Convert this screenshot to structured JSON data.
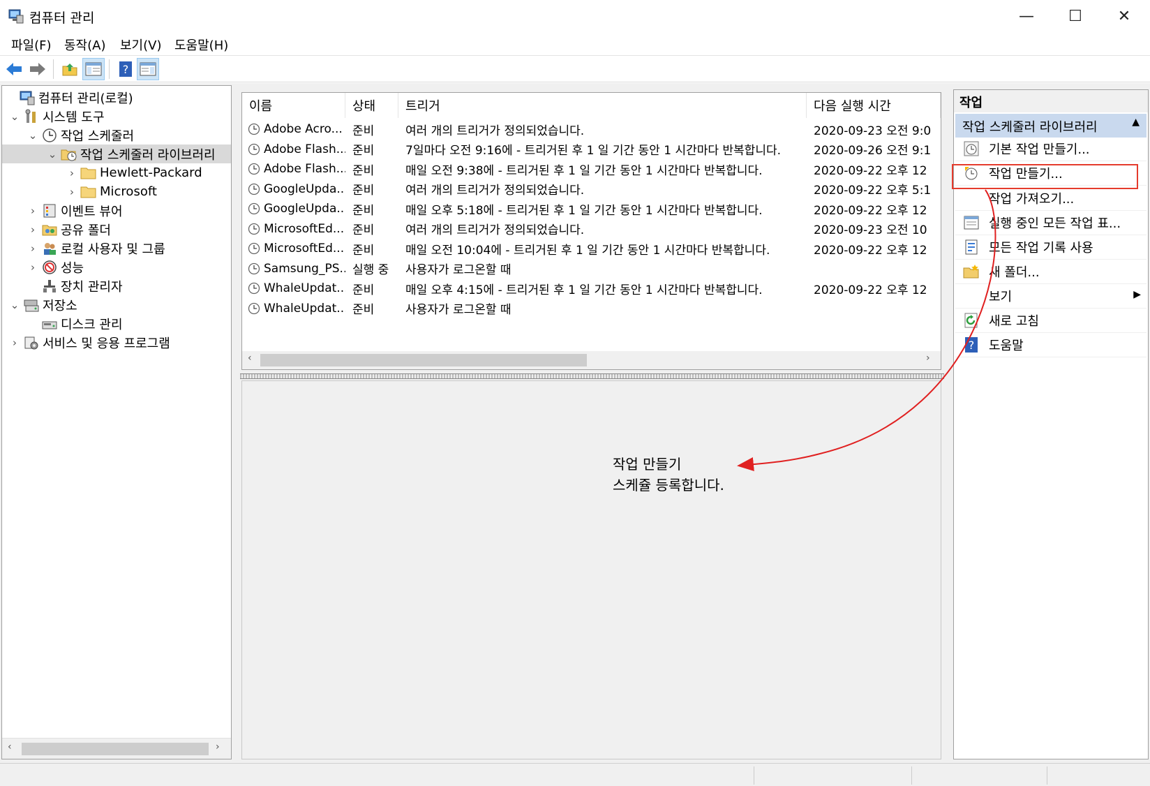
{
  "window": {
    "title": "컴퓨터 관리",
    "minimize": "—",
    "maximize": "☐",
    "close": "✕"
  },
  "menu": [
    "파일(F)",
    "동작(A)",
    "보기(V)",
    "도움말(H)"
  ],
  "tree": [
    {
      "label": "컴퓨터 관리(로컬)",
      "icon": "computer-management-icon",
      "chevron": ""
    },
    {
      "label": "시스템 도구",
      "icon": "system-tools-icon",
      "chevron": "⌄"
    },
    {
      "label": "작업 스케줄러",
      "icon": "task-scheduler-icon",
      "chevron": "⌄"
    },
    {
      "label": "작업 스케줄러 라이브러리",
      "icon": "folder-clock-icon",
      "chevron": "⌄",
      "selected": true
    },
    {
      "label": "Hewlett-Packard",
      "icon": "folder-icon",
      "chevron": "›"
    },
    {
      "label": "Microsoft",
      "icon": "folder-icon",
      "chevron": "›"
    },
    {
      "label": "이벤트 뷰어",
      "icon": "event-viewer-icon",
      "chevron": "›"
    },
    {
      "label": "공유 폴더",
      "icon": "shared-folder-icon",
      "chevron": "›"
    },
    {
      "label": "로컬 사용자 및 그룹",
      "icon": "users-icon",
      "chevron": "›"
    },
    {
      "label": "성능",
      "icon": "performance-icon",
      "chevron": "›"
    },
    {
      "label": "장치 관리자",
      "icon": "device-manager-icon",
      "chevron": ""
    },
    {
      "label": "저장소",
      "icon": "storage-icon",
      "chevron": "⌄"
    },
    {
      "label": "디스크 관리",
      "icon": "disk-icon",
      "chevron": ""
    },
    {
      "label": "서비스 및 응용 프로그램",
      "icon": "services-icon",
      "chevron": "›"
    }
  ],
  "list": {
    "columns": [
      "이름",
      "상태",
      "트리거",
      "다음 실행 시간"
    ],
    "rows": [
      [
        "Adobe Acro...",
        "준비",
        "여러 개의 트리거가 정의되었습니다.",
        "2020-09-23 오전 9:0"
      ],
      [
        "Adobe Flash...",
        "준비",
        "7일마다 오전 9:16에 - 트리거된 후 1 일 기간 동안 1 시간마다 반복합니다.",
        "2020-09-26 오전 9:1"
      ],
      [
        "Adobe Flash...",
        "준비",
        "매일 오전 9:38에 - 트리거된 후 1 일 기간 동안 1 시간마다 반복합니다.",
        "2020-09-22 오후 12"
      ],
      [
        "GoogleUpda...",
        "준비",
        "여러 개의 트리거가 정의되었습니다.",
        "2020-09-22 오후 5:1"
      ],
      [
        "GoogleUpda...",
        "준비",
        "매일 오후 5:18에 - 트리거된 후 1 일 기간 동안 1 시간마다 반복합니다.",
        "2020-09-22 오후 12"
      ],
      [
        "MicrosoftEd...",
        "준비",
        "여러 개의 트리거가 정의되었습니다.",
        "2020-09-23 오전 10"
      ],
      [
        "MicrosoftEd...",
        "준비",
        "매일 오전 10:04에 - 트리거된 후 1 일 기간 동안 1 시간마다 반복합니다.",
        "2020-09-22 오후 12"
      ],
      [
        "Samsung_PS...",
        "실행 중",
        "사용자가 로그온할 때",
        ""
      ],
      [
        "WhaleUpdat...",
        "준비",
        "매일 오후 4:15에 - 트리거된 후 1 일 기간 동안 1 시간마다 반복합니다.",
        "2020-09-22 오후 12"
      ],
      [
        "WhaleUpdat...",
        "준비",
        "사용자가 로그온할 때",
        ""
      ]
    ]
  },
  "actions": {
    "header": "작업",
    "section": "작업 스케줄러 라이브러리",
    "items": [
      {
        "label": "기본 작업 만들기...",
        "icon": "basic-task-icon"
      },
      {
        "label": "작업 만들기...",
        "icon": "create-task-icon"
      },
      {
        "label": "작업 가져오기...",
        "icon": ""
      },
      {
        "label": "실행 중인 모든 작업 표...",
        "icon": "running-tasks-icon"
      },
      {
        "label": "모든 작업 기록 사용",
        "icon": "history-icon"
      },
      {
        "label": "새 폴더...",
        "icon": "new-folder-icon"
      },
      {
        "label": "보기",
        "icon": "",
        "submenu": true
      },
      {
        "label": "새로 고침",
        "icon": "refresh-icon"
      },
      {
        "label": "도움말",
        "icon": "help-icon"
      }
    ]
  },
  "annotation": {
    "line1": "작업 만들기",
    "line2": "스케쥴 등록합니다."
  },
  "colors": {
    "highlight": "#e53b2c",
    "section_bg": "#c9d9ee",
    "selection": "#d9d9d9"
  }
}
